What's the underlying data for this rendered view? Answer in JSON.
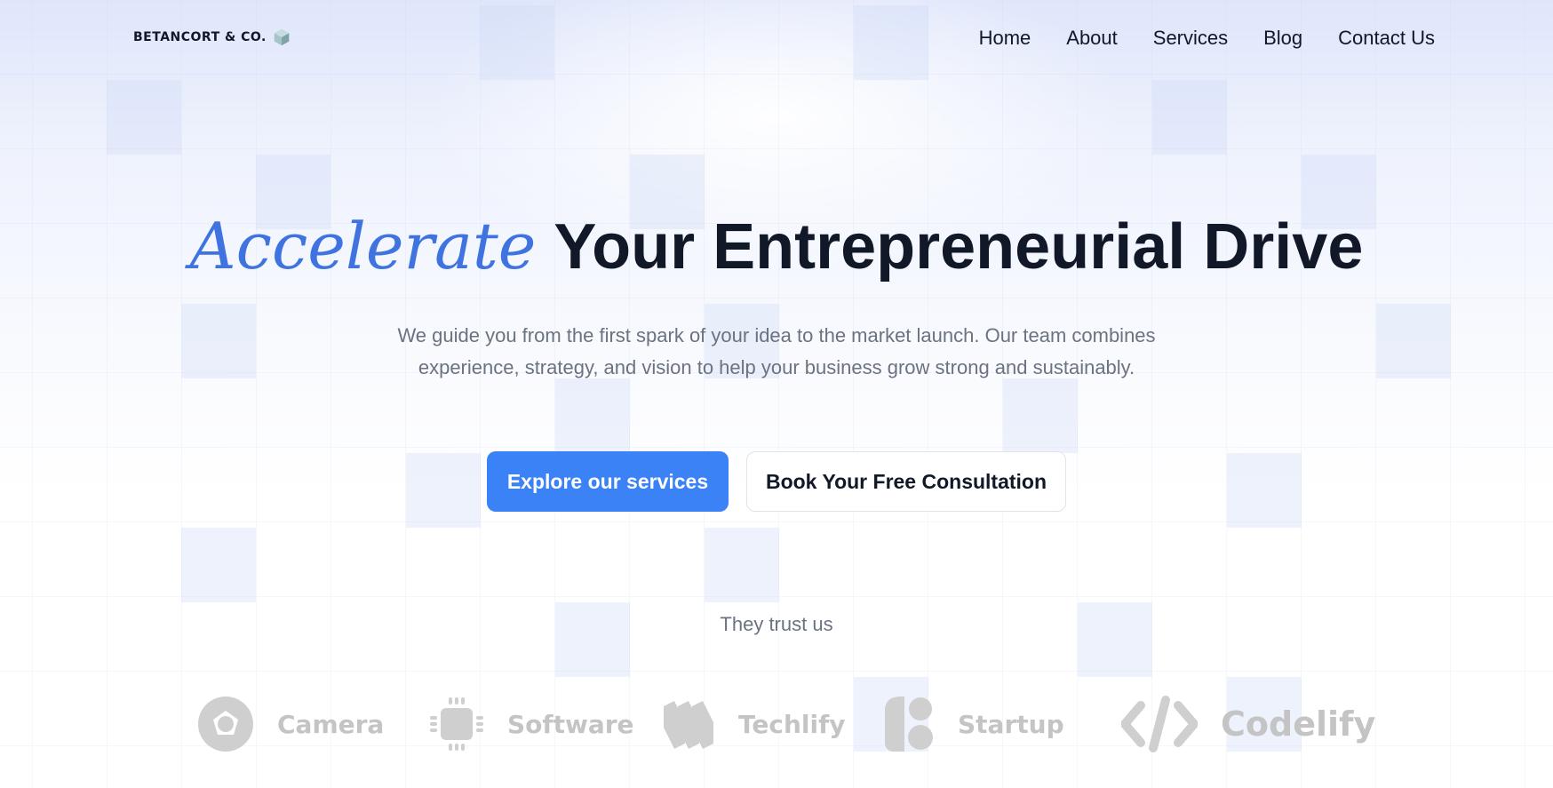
{
  "header": {
    "logo_text": "BETANCORT & CO.",
    "nav": [
      {
        "label": "Home"
      },
      {
        "label": "About"
      },
      {
        "label": "Services"
      },
      {
        "label": "Blog"
      },
      {
        "label": "Contact Us"
      }
    ]
  },
  "hero": {
    "title_accent": "Accelerate",
    "title_rest": "Your Entrepreneurial Drive",
    "subtitle": "We guide you from the first spark of your idea to the market launch. Our team combines experience, strategy, and vision to help your business grow strong and sustainably.",
    "primary_cta": "Explore our services",
    "secondary_cta": "Book Your Free Consultation"
  },
  "trust": {
    "label": "They trust us",
    "brands": [
      {
        "name": "Camera",
        "icon": "camera-aperture-icon"
      },
      {
        "name": "Software",
        "icon": "chip-icon"
      },
      {
        "name": "Techlify",
        "icon": "stacked-stripes-icon"
      },
      {
        "name": "Startup",
        "icon": "blocks-icon"
      },
      {
        "name": "Codelify",
        "icon": "code-brackets-icon"
      }
    ]
  },
  "colors": {
    "accent": "#3f74e0",
    "primary_button": "#3b82f6",
    "heading": "#111827",
    "body_text": "#6b7280",
    "brand_logo_gray": "#c9c9c9"
  }
}
